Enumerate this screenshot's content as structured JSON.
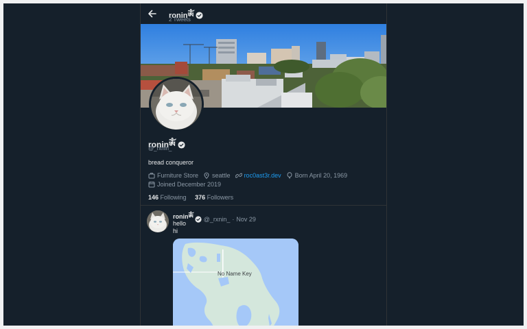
{
  "header": {
    "name": "roninༀ",
    "tweet_count": "2 Tweets"
  },
  "profile": {
    "name": "roninༀ",
    "handle": "@_rxnin_",
    "bio": "bread conqueror",
    "category": "Furniture Store",
    "location": "seattle",
    "website": "roc0ast3r.dev",
    "born": "Born April 20, 1969",
    "joined": "Joined December 2019",
    "following_count": "146",
    "following_label": "Following",
    "followers_count": "376",
    "followers_label": "Followers"
  },
  "tweet": {
    "name": "roninༀ",
    "handle": "@_rxnin_",
    "separator": "·",
    "date": "Nov 29",
    "lines": [
      "hello",
      "hi"
    ],
    "map_label": "No Name Key"
  },
  "colors": {
    "background": "#15202b",
    "text": "#e7e9ea",
    "muted": "#8b98a5",
    "link": "#1d9bf0",
    "border": "#2f3336",
    "map_water": "#a5c8f8",
    "map_land": "#d4e7dc"
  },
  "icons": {
    "back": "arrow-left-icon",
    "verified": "verified-badge-icon",
    "category": "briefcase-icon",
    "location": "location-pin-icon",
    "website": "link-icon",
    "born": "balloon-icon",
    "joined": "calendar-icon"
  }
}
